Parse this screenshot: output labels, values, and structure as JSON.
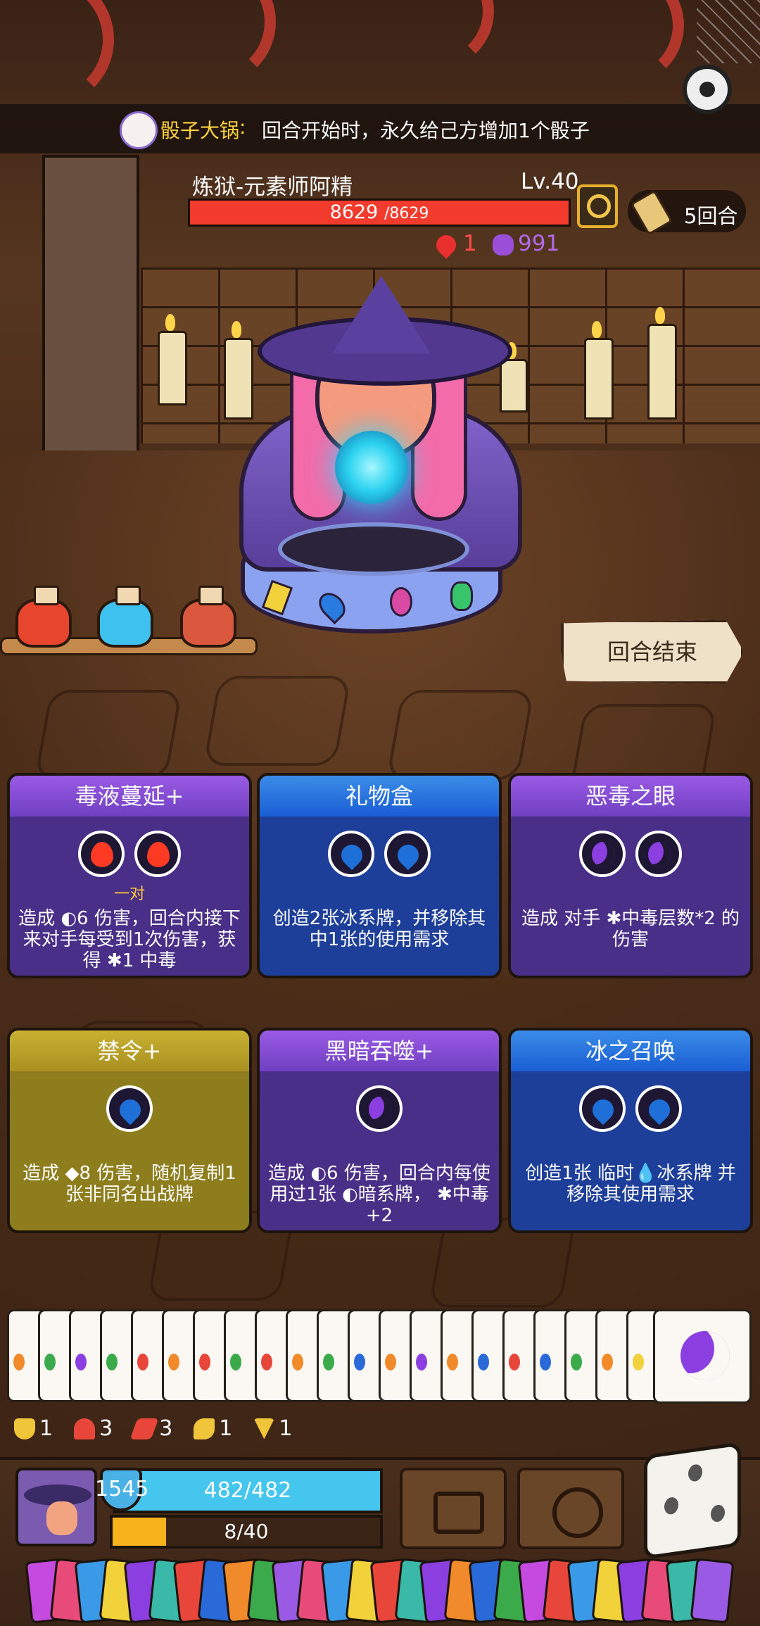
{
  "banner": {
    "item_name": "骰子大锅",
    "item_sep": ":",
    "item_desc": "回合开始时，永久给己方增加1个骰子"
  },
  "enemy": {
    "name": "炼狱-元素师阿精",
    "level": "Lv.40",
    "hp_current": "8629",
    "hp_max": "/8629",
    "hp_fraction": 1.0,
    "bleed_count": "1",
    "poison_count": "991"
  },
  "round": {
    "label": "5回合"
  },
  "end_turn": {
    "label": "回合结束"
  },
  "cards": [
    {
      "title": "毒液蔓延+",
      "theme": "purple",
      "slots": [
        "fire",
        "fire"
      ],
      "pair_label": "一对",
      "desc": "造成 ◐6 伤害，回合内接下来对手每受到1次伤害，获得 ✱1 中毒"
    },
    {
      "title": "礼物盒",
      "theme": "blue",
      "slots": [
        "water",
        "water"
      ],
      "pair_label": "",
      "desc": "创造2张冰系牌，并移除其中1张的使用需求"
    },
    {
      "title": "恶毒之眼",
      "theme": "purple",
      "slots": [
        "moon",
        "moon"
      ],
      "pair_label": "",
      "desc": "造成 对手 ✱中毒层数*2 的伤害"
    },
    {
      "title": "禁令+",
      "theme": "yellow",
      "slots": [
        "water"
      ],
      "pair_label": "",
      "desc": "造成 ◆8 伤害，随机复制1张非同名出战牌"
    },
    {
      "title": "黑暗吞噬+",
      "theme": "purple",
      "slots": [
        "moon"
      ],
      "pair_label": "",
      "desc": "造成 ◐6 伤害，回合内每使用过1张 ◐暗系牌， ✱中毒+2"
    },
    {
      "title": "冰之召唤",
      "theme": "blue",
      "slots": [
        "water",
        "water"
      ],
      "pair_label": "",
      "desc": "创造1张 临时💧冰系牌 并移除其使用需求"
    }
  ],
  "buffs": [
    {
      "icon": "shield-buff-icon",
      "value": "1",
      "color": "#f0c53a"
    },
    {
      "icon": "heart-buff-icon",
      "value": "3",
      "color": "#e8463a"
    },
    {
      "icon": "claw-buff-icon",
      "value": "3",
      "color": "#e8463a"
    },
    {
      "icon": "wing-buff-icon",
      "value": "1",
      "color": "#f0c53a"
    },
    {
      "icon": "triangle-buff-icon",
      "value": "1",
      "color": "#f0c53a"
    }
  ],
  "player": {
    "armor": "1545",
    "hp": "482/482",
    "energy": "8/40",
    "energy_fraction": 0.2
  },
  "colors": {
    "purple": "#7a4ad6",
    "blue": "#1f5ed4",
    "yellow": "#b39a22",
    "hp_red": "#f23b2c",
    "hp_player": "#45c6ef"
  }
}
